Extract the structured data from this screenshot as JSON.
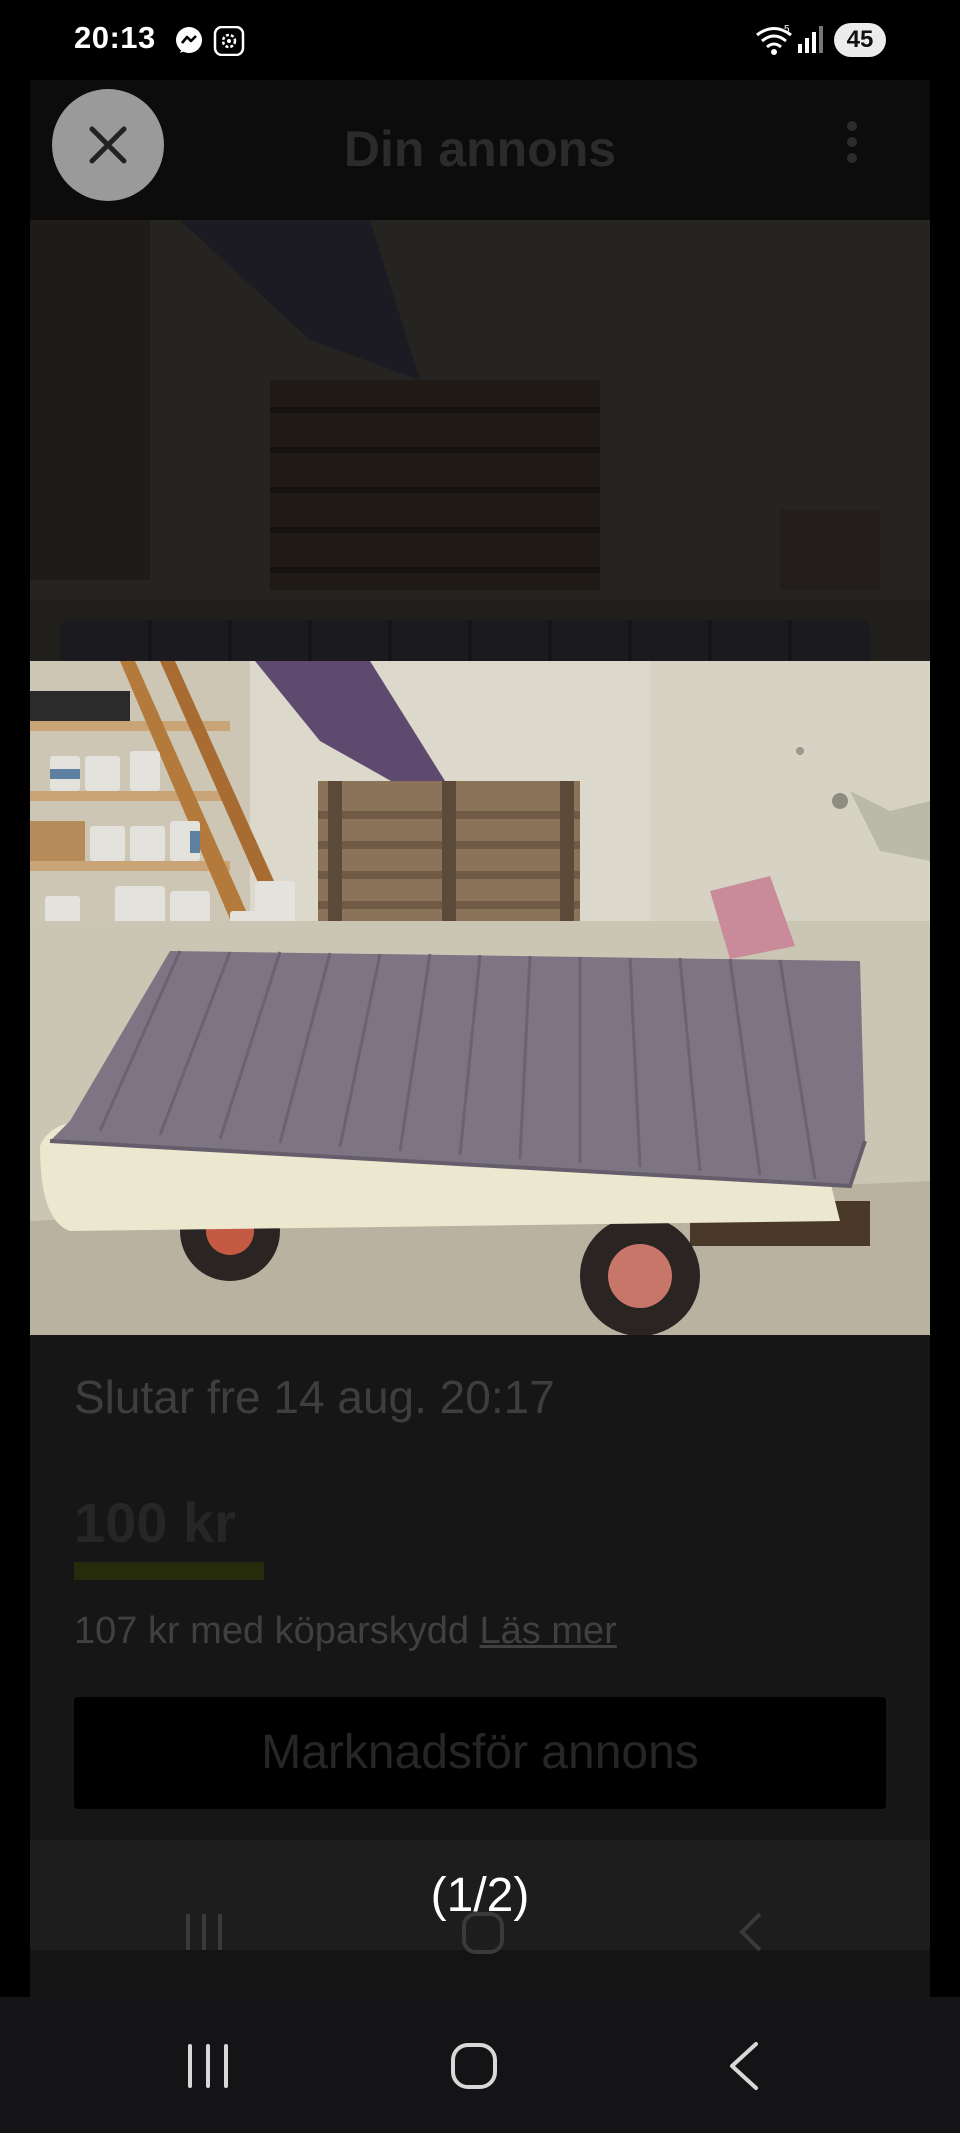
{
  "status_bar": {
    "time": "20:13",
    "battery": "45",
    "icons": [
      "messenger-icon",
      "app-notification-icon",
      "wifi-icon",
      "signal-icon"
    ]
  },
  "background_app": {
    "title": "Din annons",
    "ends_text": "Slutar fre 14 aug. 20:17",
    "price": "100 kr",
    "buyer_protection_text": "107 kr med köparskydd ",
    "read_more": "Läs mer",
    "promote_button": "Marknadsför annons"
  },
  "viewer": {
    "counter": "(1/2)",
    "current_index": 1,
    "total_images": 2
  },
  "colors": {
    "close_button": "#9a9a9a",
    "navbar": "#141416",
    "battery_badge": "#ececec"
  }
}
